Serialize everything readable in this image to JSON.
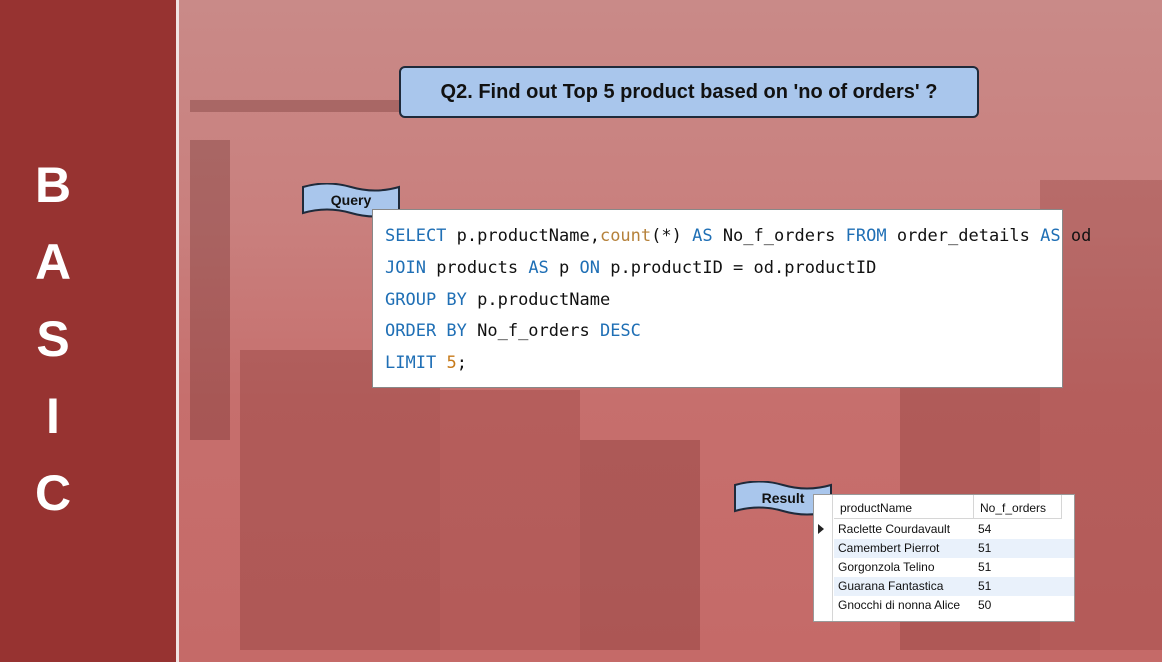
{
  "sidebar": {
    "letters": [
      "B",
      "A",
      "S",
      "I",
      "C"
    ]
  },
  "question": {
    "text": "Q2. Find out Top 5 product based on 'no of orders' ?"
  },
  "query": {
    "tag": "Query",
    "lines": [
      "SELECT p.productName,count(*) AS No_f_orders FROM order_details AS od",
      "JOIN products AS p ON p.productID = od.productID",
      "GROUP BY p.productName",
      "ORDER BY No_f_orders DESC",
      "LIMIT 5;"
    ]
  },
  "result": {
    "tag": "Result",
    "columns": [
      "productName",
      "No_f_orders"
    ],
    "rows": [
      [
        "Raclette Courdavault",
        "54"
      ],
      [
        "Camembert Pierrot",
        "51"
      ],
      [
        "Gorgonzola Telino",
        "51"
      ],
      [
        "Guarana Fantastica",
        "51"
      ],
      [
        "Gnocchi di nonna Alice",
        "50"
      ]
    ]
  },
  "colors": {
    "sidebar": "#973331",
    "question_bg": "#a9c6ec",
    "keyword": "#1f6fb5",
    "number": "#c77a1a"
  }
}
